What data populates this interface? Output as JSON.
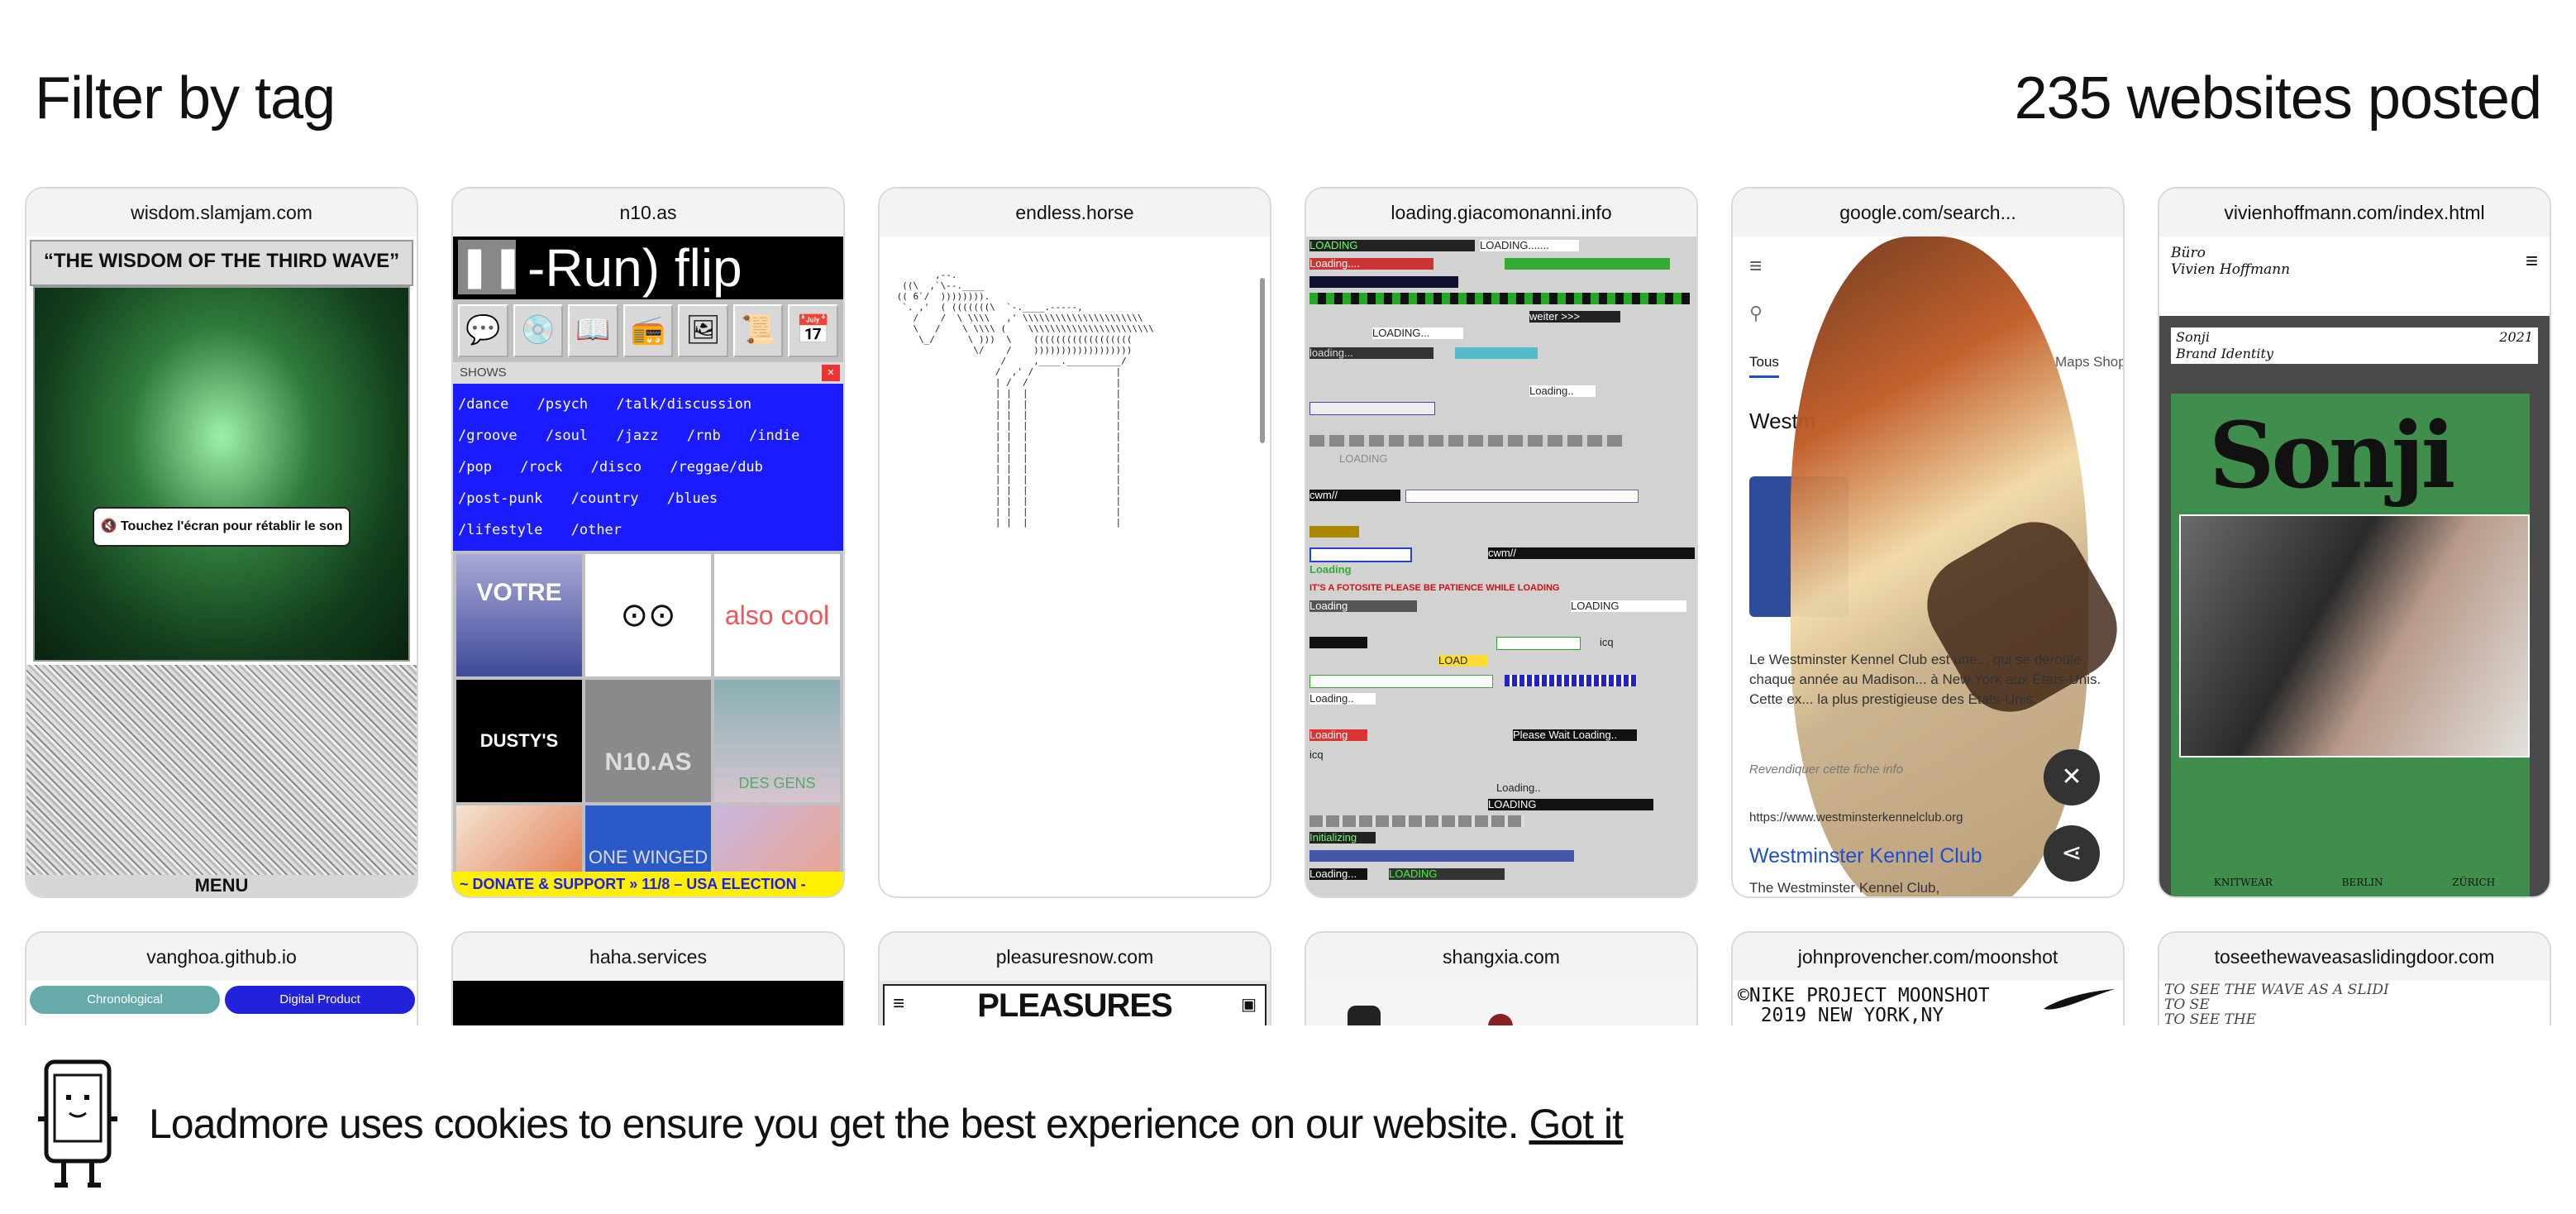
{
  "header": {
    "filter_label": "Filter by tag",
    "count_label": "235 websites posted"
  },
  "cards": [
    {
      "title": "wisdom.slamjam.com",
      "heading": "“THE WISDOM OF THE THIRD WAVE”",
      "button": "Touchez l'écran pour rétablir le son",
      "menu": "MENU"
    },
    {
      "title": "n10.as",
      "marquee": "-Run)    flip",
      "panel": "SHOWS",
      "tags": [
        "/dance",
        "/psych",
        "/talk/discussion",
        "/groove",
        "/soul",
        "/jazz",
        "/rnb",
        "/indie",
        "/pop",
        "/rock",
        "/disco",
        "/reggae/dub",
        "/post-punk",
        "/country",
        "/blues",
        "/lifestyle",
        "/other"
      ],
      "thumb_texts": [
        "VOTRE",
        "",
        "also cool",
        "DUSTY'S DIARIES",
        "N10.AS",
        "DES GENS",
        "",
        "ONE WINGED ANGEL",
        ""
      ],
      "footer": "~ DONATE & SUPPORT   »   11/8 – USA ELECTION -"
    },
    {
      "title": "endless.horse"
    },
    {
      "title": "loading.giacomonanni.info",
      "snippets": [
        "LOADING",
        "LOADING.......",
        "Loading....",
        "weiter >>>",
        "LOADING...",
        "loading...",
        "Loading..",
        "LOADING",
        "cwm//",
        "Loading",
        "IT'S A FOTOSITE PLEASE BE PATIENCE WHILE LOADING",
        "Please Wait Loading..",
        "Loading..",
        "Initializing",
        "Loading...",
        "LOADING",
        "icq",
        "LOAD"
      ]
    },
    {
      "title": "google.com/search...",
      "tabs": [
        "Tous",
        "Maps",
        "Shop"
      ],
      "result_heading": "Westm",
      "snippet": "Le Westminster Kennel Club est une... qui se déroule chaque année au Madison... à New York aux États-Unis. Cette ex... la plus prestigieuse des États-Unis.",
      "claim": "Revendiquer cette fiche info",
      "url": "https://www.westminsterkennelclub.org",
      "link": "Westminster Kennel Club",
      "sub": "The Westminster Kennel Club,"
    },
    {
      "title": "vivienhoffmann.com/index.html",
      "studio": "Büro\nVivien Hoffmann",
      "project": "Sonji\nBrand Identity",
      "year": "2021",
      "logo": "Sonji",
      "footer": [
        "KNITWEAR",
        "BERLIN",
        "ZÜRICH"
      ]
    }
  ],
  "row2": [
    {
      "title": "vanghoa.github.io",
      "buttons": [
        "Chronological",
        "Digital Product"
      ]
    },
    {
      "title": "haha.services"
    },
    {
      "title": "pleasuresnow.com",
      "heading": "PLEASURES"
    },
    {
      "title": "shangxia.com"
    },
    {
      "title": "johnprovencher.com/moonshot",
      "text": "©NIKE PROJECT MOONSHOT\n  2019 NEW YORK,NY"
    },
    {
      "title": "toseethewaveasaslidingdoor.com",
      "text": "TO SEE THE WAVE AS A SLIDI\nTO SE\nTO SEE THE"
    }
  ],
  "cookie": {
    "text": "Loadmore uses cookies to ensure you get the best experience on our website.",
    "action": "Got it"
  }
}
